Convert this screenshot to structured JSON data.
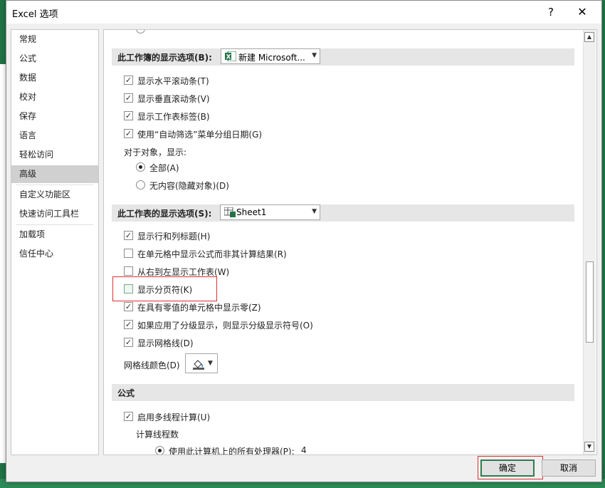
{
  "window": {
    "title": "Excel 选项",
    "help_label": "?",
    "close_label": "✕"
  },
  "nav": {
    "items": [
      {
        "label": "常规"
      },
      {
        "label": "公式"
      },
      {
        "label": "数据"
      },
      {
        "label": "校对"
      },
      {
        "label": "保存"
      },
      {
        "label": "语言"
      },
      {
        "label": "轻松访问"
      },
      {
        "label": "高级",
        "active": true
      },
      {
        "label": "自定义功能区"
      },
      {
        "label": "快速访问工具栏"
      },
      {
        "label": "加载项"
      },
      {
        "label": "信任中心"
      }
    ]
  },
  "workbook_section": {
    "header": "此工作簿的显示选项(B):",
    "combo_value": "新建 Microsoft...",
    "options": [
      {
        "label": "显示水平滚动条(T)",
        "checked": true
      },
      {
        "label": "显示垂直滚动条(V)",
        "checked": true
      },
      {
        "label": "显示工作表标签(B)",
        "checked": true
      },
      {
        "label": "使用“自动筛选”菜单分组日期(G)",
        "checked": true
      }
    ],
    "objects_label": "对于对象，显示:",
    "radio_all": "全部(A)",
    "radio_none": "无内容(隐藏对象)(D)"
  },
  "worksheet_section": {
    "header": "此工作表的显示选项(S):",
    "combo_value": "Sheet1",
    "options": [
      {
        "label": "显示行和列标题(H)",
        "checked": true
      },
      {
        "label": "在单元格中显示公式而非其计算结果(R)",
        "checked": false
      },
      {
        "label": "从右到左显示工作表(W)",
        "checked": false
      },
      {
        "label": "显示分页符(K)",
        "checked": false
      },
      {
        "label": "在具有零值的单元格中显示零(Z)",
        "checked": true
      },
      {
        "label": "如果应用了分级显示，则显示分级显示符号(O)",
        "checked": true
      },
      {
        "label": "显示网格线(D)",
        "checked": true
      }
    ],
    "gridline_color_label": "网格线颜色(D)"
  },
  "formula_section": {
    "header": "公式",
    "multithread_label": "启用多线程计算(U)",
    "threads_label": "计算线程数",
    "use_all_label": "使用此计算机上的所有处理器(P):",
    "processor_count": "4"
  },
  "buttons": {
    "ok": "确定",
    "cancel": "取消"
  },
  "colors": {
    "accent": "#217346",
    "highlight": "#e03030"
  }
}
